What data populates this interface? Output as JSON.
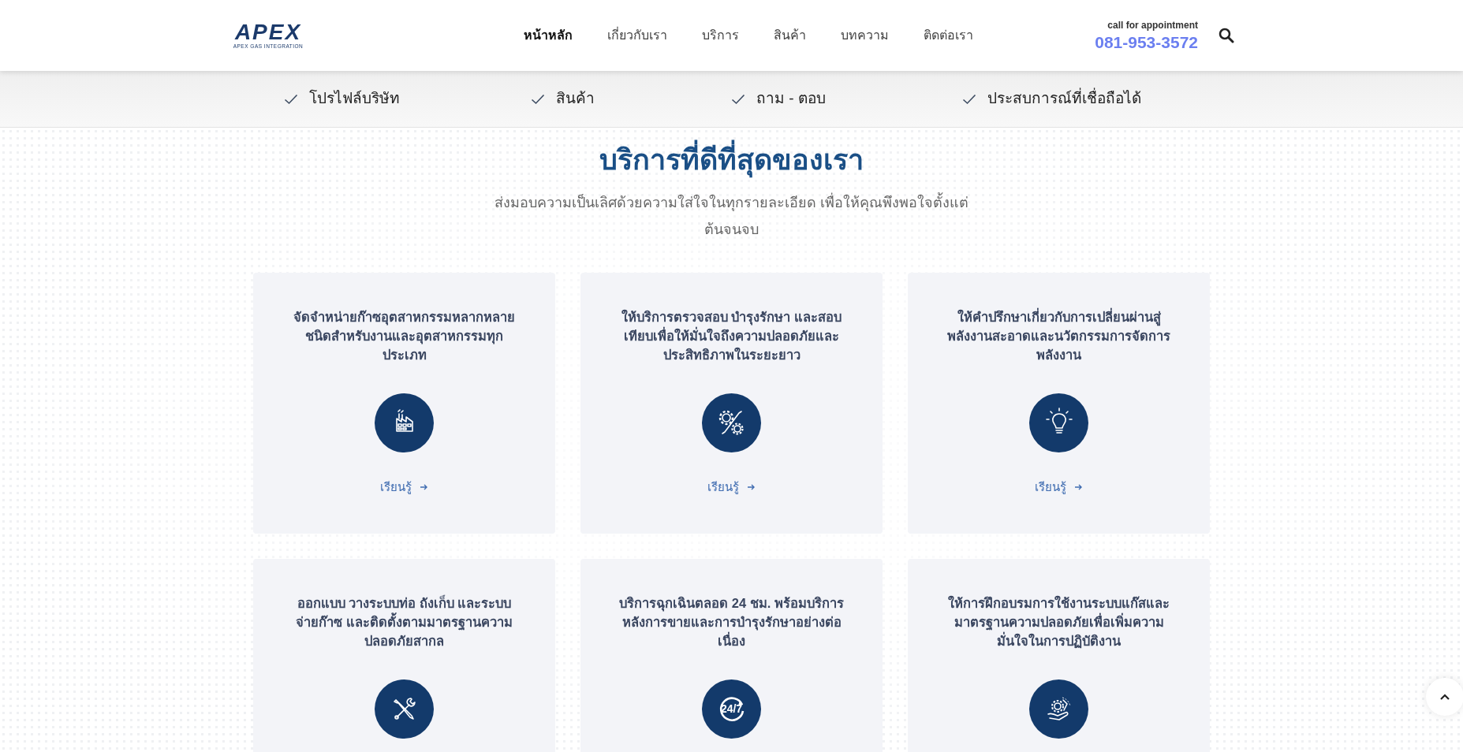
{
  "header": {
    "logo": {
      "wordmark": "APEX",
      "tagline": "APEX GAS INTEGRATION"
    },
    "nav": [
      {
        "label": "หน้าหลัก",
        "selected": true
      },
      {
        "label": "เกี่ยวกับเรา",
        "selected": false
      },
      {
        "label": "บริการ",
        "selected": false
      },
      {
        "label": "สินค้า",
        "selected": false
      },
      {
        "label": "บทความ",
        "selected": false
      },
      {
        "label": "ติดต่อเรา",
        "selected": false
      }
    ],
    "contact": {
      "caption": "call for appointment",
      "phone": "081-953-3572"
    }
  },
  "highlights": [
    "โปรไฟล์บริษัท",
    "สินค้า",
    "ถาม - ตอบ",
    "ประสบการณ์ที่เชื่อถือได้"
  ],
  "services": {
    "title": "บริการที่ดีที่สุดของเรา",
    "subtitle": "ส่งมอบความเป็นเลิศด้วยความใส่ใจในทุกรายละเอียด เพื่อให้คุณพึงพอใจตั้งแต่ต้นจนจบ",
    "cards": [
      {
        "text": "จัดจำหน่ายก๊าซอุตสาหกรรมหลากหลายชนิดสำหรับงานและอุตสาหกรรมทุกประเภท",
        "link": "เรียนรู้"
      },
      {
        "text": "ให้บริการตรวจสอบ บำรุงรักษา และสอบเทียบเพื่อให้มั่นใจถึงความปลอดภัยและประสิทธิภาพในระยะยาว",
        "link": "เรียนรู้"
      },
      {
        "text": "ให้คำปรึกษาเกี่ยวกับการเปลี่ยนผ่านสู่พลังงานสะอาดและนวัตกรรมการจัดการพลังงาน",
        "link": "เรียนรู้"
      },
      {
        "text": "ออกแบบ วางระบบท่อ ถังเก็บ และระบบจ่ายก๊าซ และติดตั้งตามมาตรฐานความปลอดภัยสากล"
      },
      {
        "text": "บริการฉุกเฉินตลอด 24 ชม. พร้อมบริการหลังการขายและการบำรุงรักษาอย่างต่อเนื่อง",
        "icon_text": "24/7"
      },
      {
        "text": "ให้การฝึกอบรมการใช้งานระบบแก๊สและมาตรฐานความปลอดภัยเพื่อเพิ่มความมั่นใจในการปฏิบัติงาน"
      }
    ]
  }
}
